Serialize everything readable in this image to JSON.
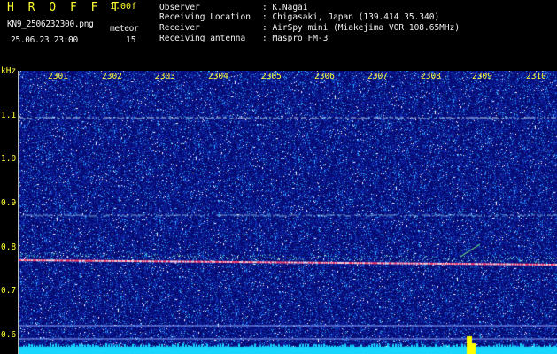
{
  "header": {
    "app_title": "H R O F F T",
    "version": "1.00f",
    "filename": "KN9_2506232300.png",
    "datetime": "25.06.23 23:00",
    "mode": "meteor",
    "count": "15",
    "fields": [
      {
        "label": "Observer",
        "value": ": K.Nagai"
      },
      {
        "label": "Receiving Location",
        "value": ": Chigasaki, Japan (139.414 35.340)"
      },
      {
        "label": "Receiver",
        "value": ": AirSpy mini (Miakejima VOR 108.65MHz)"
      },
      {
        "label": "Receiving antenna",
        "value": ": Maspro FM-3"
      }
    ]
  },
  "spectrogram": {
    "y_unit": "kHz",
    "x_ticks": [
      "2301",
      "2302",
      "2303",
      "2304",
      "2305",
      "2306",
      "2307",
      "2308",
      "2309",
      "2310"
    ],
    "y_ticks": [
      "1.1",
      "1.0",
      "0.9",
      "0.8",
      "0.7",
      "0.6"
    ],
    "carrier_khz": 0.78,
    "background_color": "#0b0f86",
    "text_color": "#ffff33",
    "baseline_color": "#19d6ff"
  }
}
